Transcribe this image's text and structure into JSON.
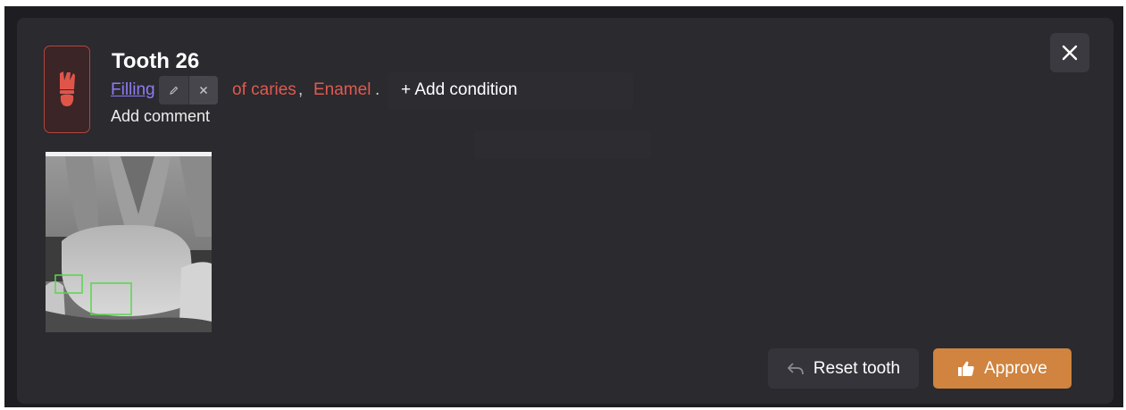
{
  "tooth": {
    "title": "Tooth 26",
    "icon": "tooth-icon"
  },
  "conditions": {
    "items": [
      {
        "label": "Filling",
        "color": "#8e7cf0"
      },
      {
        "label": "of caries",
        "color": "#e05a4f"
      },
      {
        "label": "Enamel",
        "color": "#e05a4f"
      }
    ],
    "separator": ",",
    "terminator": ".",
    "add_condition_label": "+ Add condition",
    "edit_icon": "pencil-icon",
    "remove_icon": "close-icon"
  },
  "comment": {
    "add_comment_label": "Add comment"
  },
  "actions": {
    "reset_label": "Reset tooth",
    "reset_icon": "undo-icon",
    "approve_label": "Approve",
    "approve_icon": "thumbs-up-icon",
    "close_icon": "close-icon"
  },
  "colors": {
    "accent": "#d0843f",
    "card_bg": "#2a2a2f",
    "badge_border": "#b2453f",
    "detection_box": "#59d64c"
  }
}
